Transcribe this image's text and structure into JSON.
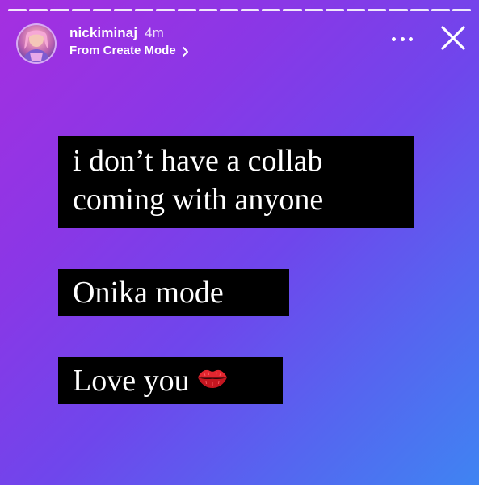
{
  "story": {
    "segment_count": 22,
    "user": {
      "username": "nickiminaj",
      "time_ago": "4m",
      "source_label": "From Create Mode",
      "avatar_icon": "profile-photo-avatar"
    },
    "actions": {
      "more_icon": "more-horizontal-icon",
      "close_icon": "close-icon"
    },
    "captions": [
      {
        "text": "i don’t have a collab\ncoming with anyone"
      },
      {
        "text": "Onika mode"
      },
      {
        "text": "Love you",
        "emoji_icon": "kiss-mark-icon"
      }
    ],
    "colors": {
      "gradient_start": "#a52fe0",
      "gradient_end": "#3f84f2",
      "caption_bg": "#000000",
      "text": "#ffffff"
    }
  }
}
